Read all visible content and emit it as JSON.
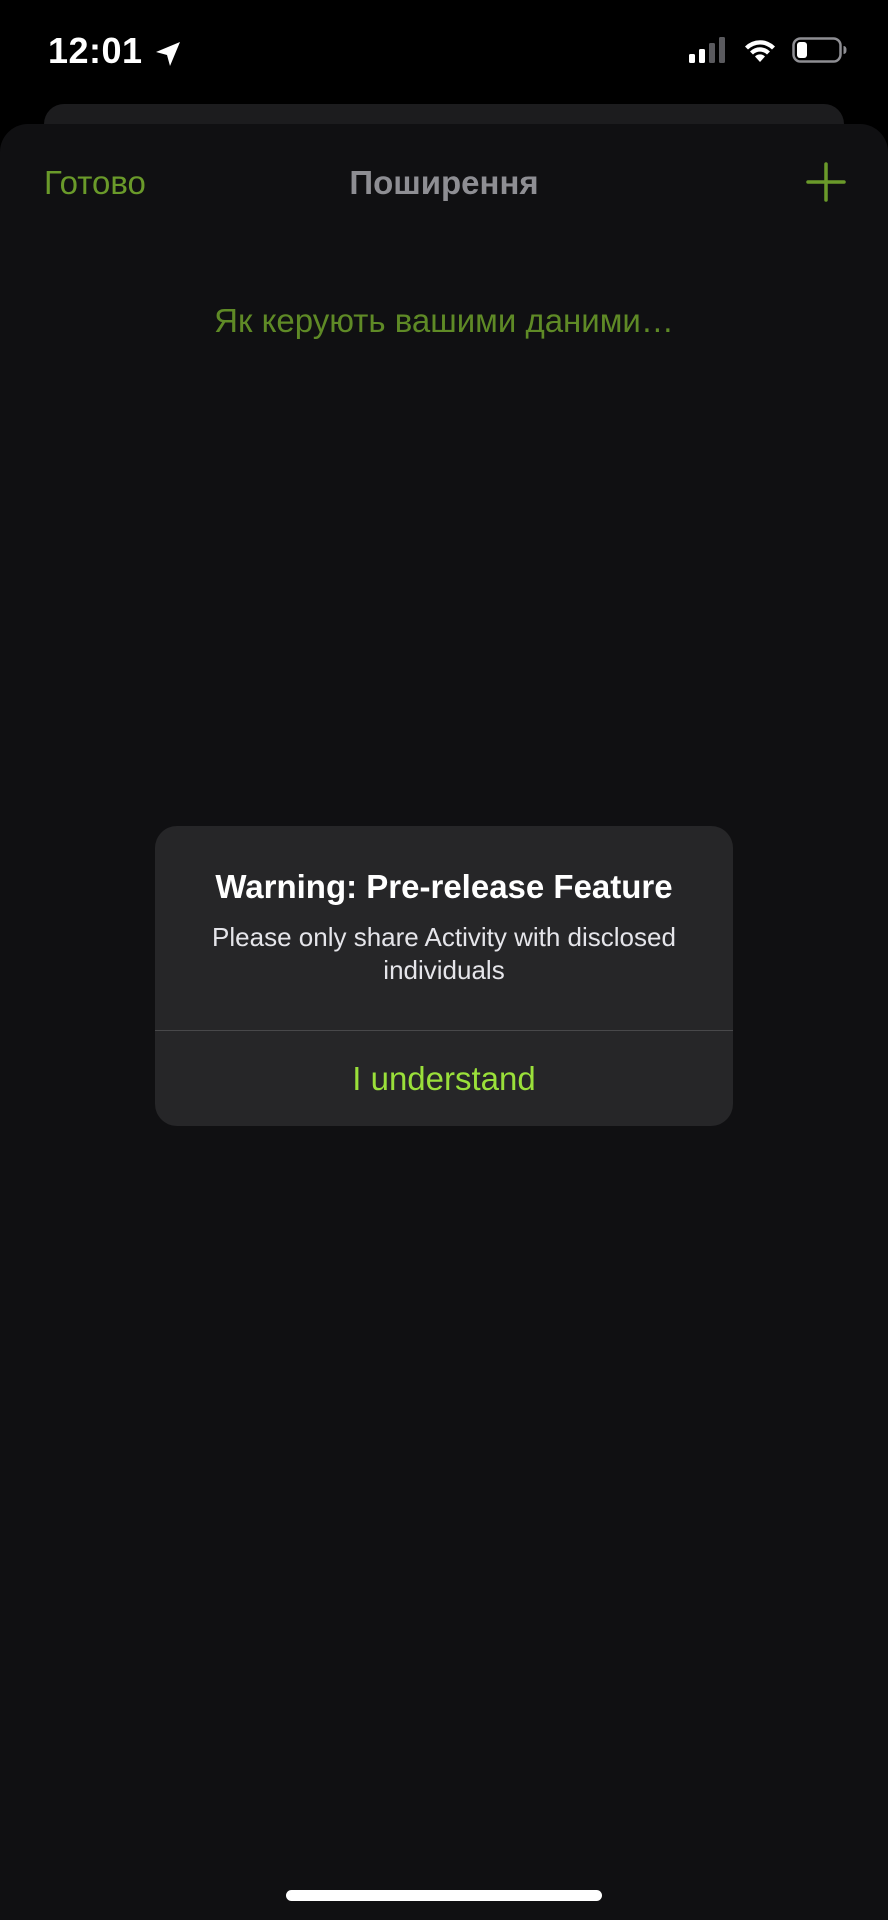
{
  "status_bar": {
    "time": "12:01",
    "icons": [
      "location-arrow-icon",
      "cellular-signal-icon",
      "wifi-icon",
      "battery-icon"
    ],
    "battery_level": 0.2
  },
  "nav": {
    "done_label": "Готово",
    "title": "Поширення",
    "add_icon": "plus-icon"
  },
  "content": {
    "data_link": "Як керують вашими даними…"
  },
  "alert": {
    "title": "Warning: Pre-release Feature",
    "message": "Please only share Activity with disclosed individuals",
    "button_label": "I understand"
  },
  "colors": {
    "accent": "#9ae03a",
    "accent_dim": "#6a9a2a",
    "sheet_bg": "#101012",
    "alert_bg": "#262628"
  }
}
